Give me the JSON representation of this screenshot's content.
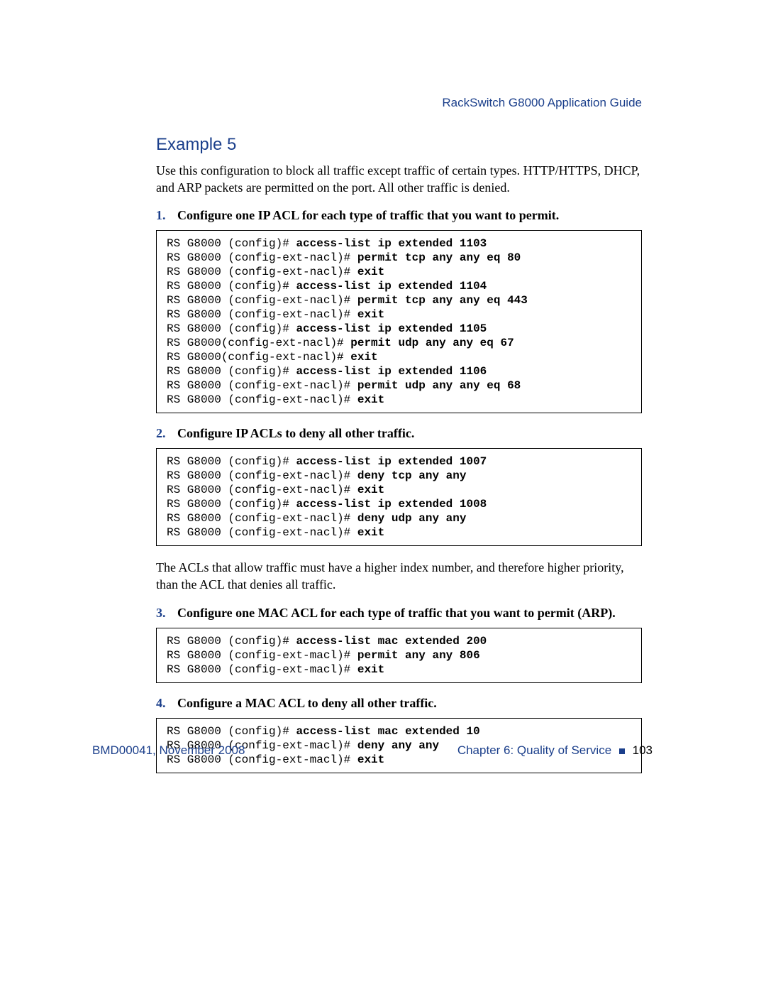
{
  "header": {
    "doc_title": "RackSwitch G8000  Application Guide"
  },
  "section": {
    "heading": "Example 5",
    "intro": "Use this configuration to block all traffic except traffic of certain types. HTTP/HTTPS, DHCP, and ARP packets are permitted on the port. All other traffic is denied."
  },
  "steps": [
    {
      "num": "1.",
      "title": "Configure one IP ACL for each type of traffic that you want to permit.",
      "code": [
        {
          "p": "RS G8000 (config)# ",
          "b": "access-list ip extended 1103"
        },
        {
          "p": "RS G8000 (config-ext-nacl)# ",
          "b": "permit tcp any any eq 80"
        },
        {
          "p": "RS G8000 (config-ext-nacl)# ",
          "b": "exit"
        },
        {
          "p": "RS G8000 (config)# ",
          "b": "access-list ip extended 1104"
        },
        {
          "p": "RS G8000 (config-ext-nacl)# ",
          "b": "permit tcp any any eq 443"
        },
        {
          "p": "RS G8000 (config-ext-nacl)# ",
          "b": "exit"
        },
        {
          "p": "RS G8000 (config)# ",
          "b": "access-list ip extended 1105"
        },
        {
          "p": "RS G8000(config-ext-nacl)# ",
          "b": "permit udp any any eq 67"
        },
        {
          "p": "RS G8000(config-ext-nacl)# ",
          "b": "exit"
        },
        {
          "p": "RS G8000 (config)# ",
          "b": "access-list ip extended 1106"
        },
        {
          "p": "RS G8000 (config-ext-nacl)# ",
          "b": "permit udp any any eq 68"
        },
        {
          "p": "RS G8000 (config-ext-nacl)# ",
          "b": "exit"
        }
      ]
    },
    {
      "num": "2.",
      "title": "Configure IP ACLs to deny all other traffic.",
      "code": [
        {
          "p": "RS G8000 (config)# ",
          "b": "access-list ip extended 1007"
        },
        {
          "p": "RS G8000 (config-ext-nacl)# ",
          "b": "deny tcp any any"
        },
        {
          "p": "RS G8000 (config-ext-nacl)# ",
          "b": "exit"
        },
        {
          "p": "RS G8000 (config)# ",
          "b": "access-list ip extended 1008"
        },
        {
          "p": "RS G8000 (config-ext-nacl)# ",
          "b": "deny udp any any"
        },
        {
          "p": "RS G8000 (config-ext-nacl)# ",
          "b": "exit"
        }
      ],
      "after": "The ACLs that allow traffic must have a higher index number, and therefore higher priority, than the ACL that denies all traffic."
    },
    {
      "num": "3.",
      "title": "Configure one MAC ACL for each type of traffic that you want to permit (ARP).",
      "code": [
        {
          "p": "RS G8000 (config)# ",
          "b": "access-list mac extended 200"
        },
        {
          "p": "RS G8000 (config-ext-macl)# ",
          "b": "permit any any 806"
        },
        {
          "p": "RS G8000 (config-ext-macl)# ",
          "b": "exit"
        }
      ]
    },
    {
      "num": "4.",
      "title": "Configure a MAC ACL to deny all other traffic.",
      "code": [
        {
          "p": "RS G8000 (config)# ",
          "b": "access-list mac extended 10"
        },
        {
          "p": "RS G8000 (config-ext-macl)# ",
          "b": "deny any any"
        },
        {
          "p": "RS G8000 (config-ext-macl)# ",
          "b": "exit"
        }
      ]
    }
  ],
  "footer": {
    "left": "BMD00041, November 2008",
    "right_chapter": "Chapter 6:  Quality of Service",
    "page_no": "103"
  }
}
